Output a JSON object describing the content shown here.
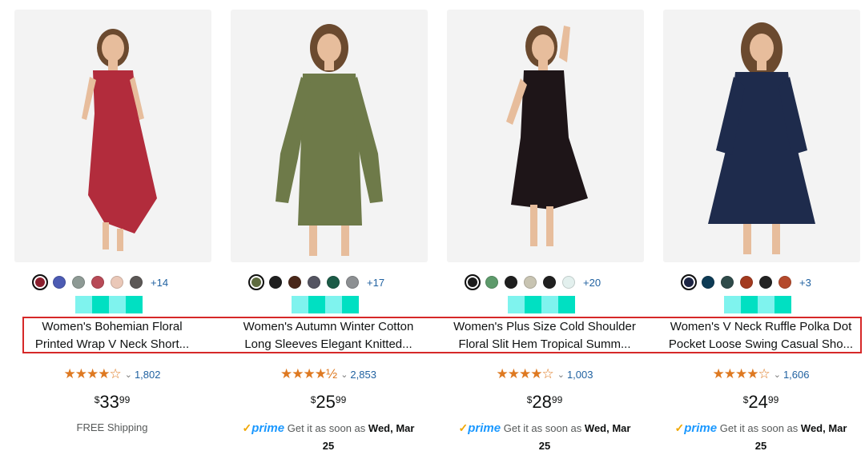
{
  "products": [
    {
      "title_line1": "Women's Bohemian Floral",
      "title_line2": "Printed Wrap V Neck Short...",
      "stars": "★★★★☆",
      "rating_count": "1,802",
      "price_symbol": "$",
      "price_whole": "33",
      "price_fraction": "99",
      "shipping": "FREE Shipping",
      "more_colors": "+14",
      "swatches": [
        "#8b1e2d",
        "#4c5bb3",
        "#8e9a95",
        "#b84a57",
        "#eac8b8",
        "#5c5856"
      ],
      "dress_color": "#b22c3c"
    },
    {
      "title_line1": "Women's Autumn Winter Cotton",
      "title_line2": "Long Sleeves Elegant Knitted...",
      "stars": "★★★★½",
      "rating_count": "2,853",
      "price_symbol": "$",
      "price_whole": "25",
      "price_fraction": "99",
      "prime_label": "prime",
      "delivery_text": "Get it as soon as",
      "delivery_date": "Wed, Mar",
      "delivery_day": "25",
      "more_colors": "+17",
      "swatches": [
        "#5e6b3f",
        "#1f1f1f",
        "#4a2719",
        "#545461",
        "#1b5b47",
        "#8c8f92"
      ],
      "dress_color": "#6e7a49"
    },
    {
      "title_line1": "Women's Plus Size Cold Shoulder",
      "title_line2": "Floral Slit Hem Tropical Summ...",
      "stars": "★★★★☆",
      "rating_count": "1,003",
      "price_symbol": "$",
      "price_whole": "28",
      "price_fraction": "99",
      "prime_label": "prime",
      "delivery_text": "Get it as soon as",
      "delivery_date": "Wed, Mar",
      "delivery_day": "25",
      "more_colors": "+20",
      "swatches": [
        "#1c1c1c",
        "#5d9a6b",
        "#1f1f1f",
        "#c8c4b2",
        "#202020",
        "#e3f0ee"
      ],
      "dress_color": "#1e1518"
    },
    {
      "title_line1": "Women's V Neck Ruffle Polka Dot",
      "title_line2": "Pocket Loose Swing Casual Sho...",
      "stars": "★★★★☆",
      "rating_count": "1,606",
      "price_symbol": "$",
      "price_whole": "24",
      "price_fraction": "99",
      "prime_label": "prime",
      "delivery_text": "Get it as soon as",
      "delivery_date": "Wed, Mar",
      "delivery_day": "25",
      "more_colors": "+3",
      "swatches": [
        "#1c2443",
        "#0d3b55",
        "#2f4b4a",
        "#a33a1f",
        "#232323",
        "#b54a2c"
      ],
      "dress_color": "#1e2b4c"
    }
  ],
  "colors": {
    "highlight_border": "#d62828",
    "strip": [
      "#7ff3ee",
      "#00e0c2",
      "#7ff3ee",
      "#00e0c2"
    ],
    "skin": "#e7bd9c",
    "hair": "#6b4a2f"
  }
}
